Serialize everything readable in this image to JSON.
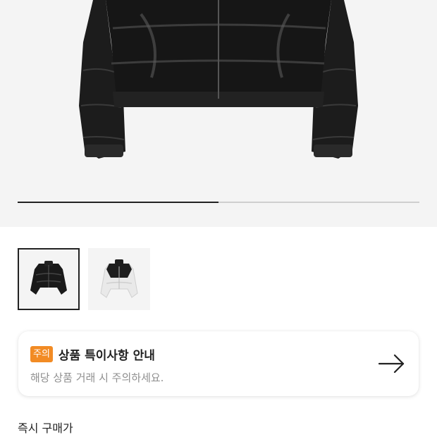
{
  "gallery": {
    "progress_fraction": 0.5,
    "thumbnails": [
      {
        "name": "black-cropped-puffer",
        "selected": true
      },
      {
        "name": "white-cropped-puffer",
        "selected": false
      }
    ]
  },
  "notice": {
    "badge": "주의",
    "title": "상품 특이사항 안내",
    "subtitle": "해당 상품 거래 시 주의하세요.",
    "icon": "arrow-right-icon",
    "badge_color": "#f28b24"
  },
  "purchase": {
    "instant_label": "즉시 구매가"
  }
}
